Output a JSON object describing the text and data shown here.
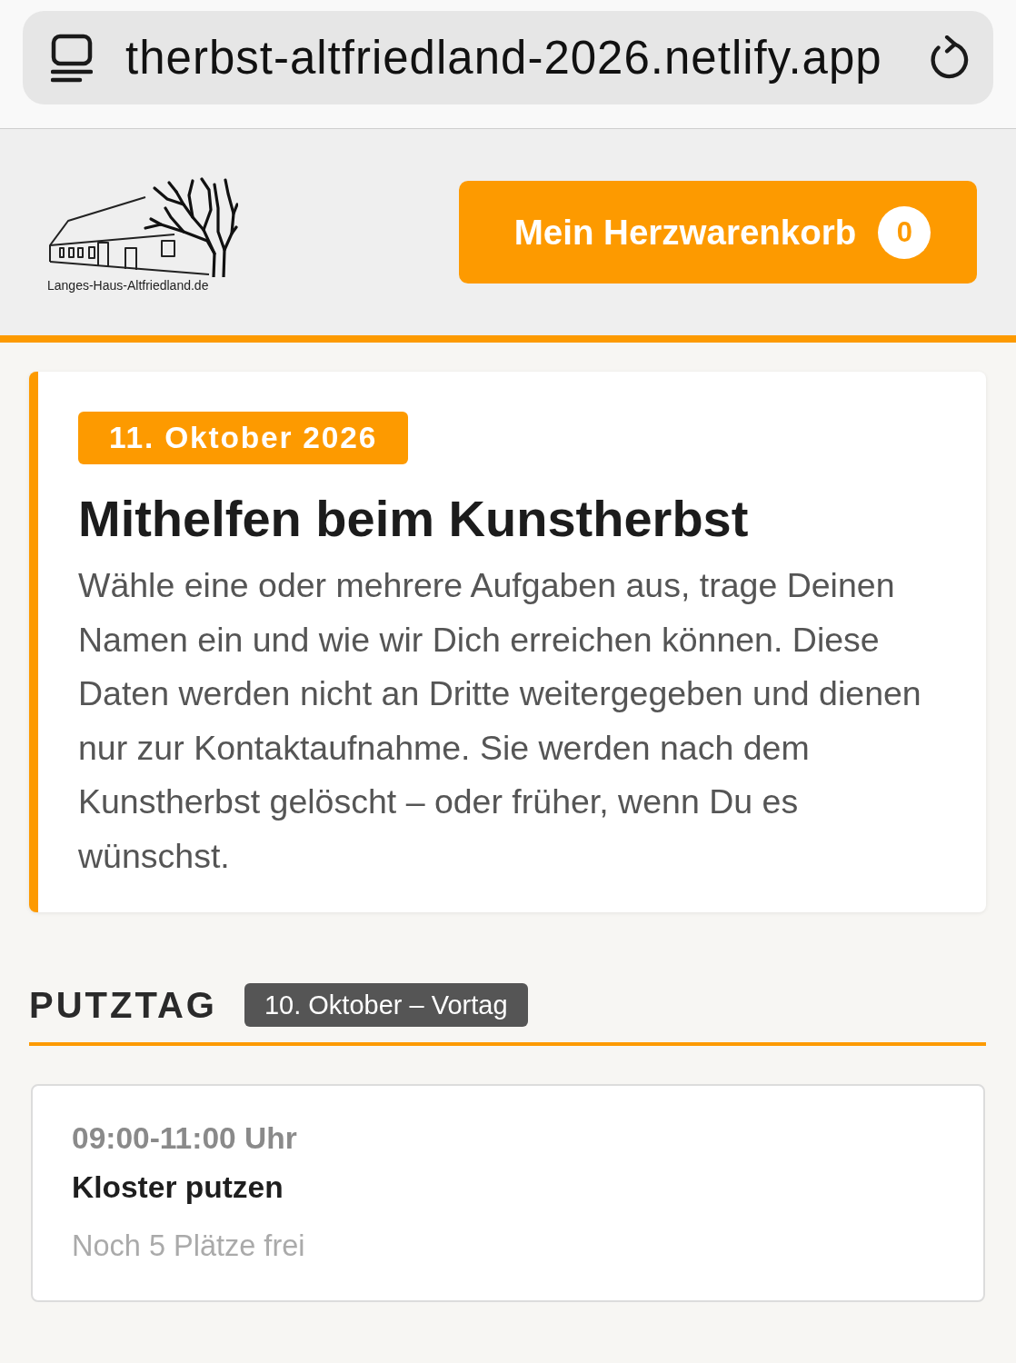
{
  "browser": {
    "url": "therbst-altfriedland-2026.netlify.app"
  },
  "header": {
    "logo": {
      "text": "Langes-Haus-Altfriedland.de"
    },
    "cart_button": {
      "label": "Mein Herzwarenkorb",
      "count": "0"
    }
  },
  "intro": {
    "date": "11. Oktober 2026",
    "title": "Mithelfen beim Kunstherbst",
    "text": "Wähle eine oder mehrere Aufgaben aus, trage Deinen Namen ein und wie wir Dich erreichen können. Diese Daten werden nicht an Dritte weitergegeben und dienen nur zur Kontaktaufnahme. Sie werden nach dem Kunstherbst gelöscht – oder früher, wenn Du es wünschst."
  },
  "sections": [
    {
      "title": "PUTZTAG",
      "tag": "10. Oktober – Vortag",
      "slots": [
        {
          "time": "09:00-11:00 Uhr",
          "task": "Kloster putzen",
          "availability": "Noch 5 Plätze frei"
        }
      ]
    }
  ]
}
